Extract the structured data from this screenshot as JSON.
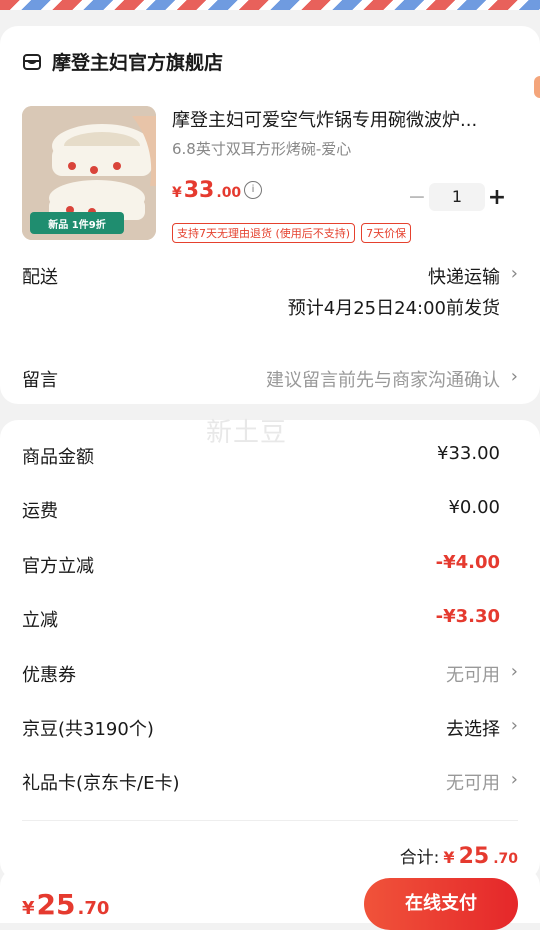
{
  "store": {
    "name": "摩登主妇官方旗舰店",
    "icon": "store-icon"
  },
  "product": {
    "title": "摩登主妇可爱空气炸锅专用碗微波炉...",
    "spec": "6.8英寸双耳方形烤碗-爱心",
    "price_currency": "¥",
    "price_main": "33",
    "price_decimal": ".00",
    "image_badge": "新品 1件9折",
    "quantity": "1",
    "minus_label": "−",
    "plus_label": "+",
    "tags": [
      "支持7天无理由退货 (使用后不支持)",
      "7天价保"
    ]
  },
  "delivery": {
    "label": "配送",
    "method": "快递运输",
    "eta": "预计4月25日24:00前发货"
  },
  "message": {
    "label": "留言",
    "placeholder": "建议留言前先与商家沟通确认"
  },
  "watermark": "新土豆",
  "summary": {
    "rows": [
      {
        "label": "商品金额",
        "value": "¥33.00"
      },
      {
        "label": "运费",
        "value": "¥0.00"
      },
      {
        "label": "官方立减",
        "value": "-¥4.00"
      },
      {
        "label": "立减",
        "value": "-¥3.30"
      },
      {
        "label": "优惠券",
        "value": "无可用"
      },
      {
        "label": "京豆(共3190个)",
        "value": "去选择"
      },
      {
        "label": "礼品卡(京东卡/E卡)",
        "value": "无可用"
      }
    ],
    "total_label": "合计:",
    "total_currency": "¥",
    "total_main": "25",
    "total_decimal": ".70"
  },
  "footer": {
    "currency": "¥",
    "main": "25",
    "decimal": ".70",
    "pay_label": "在线支付"
  },
  "colors": {
    "accent": "#e53a2f",
    "badge": "#1f8d6f"
  }
}
